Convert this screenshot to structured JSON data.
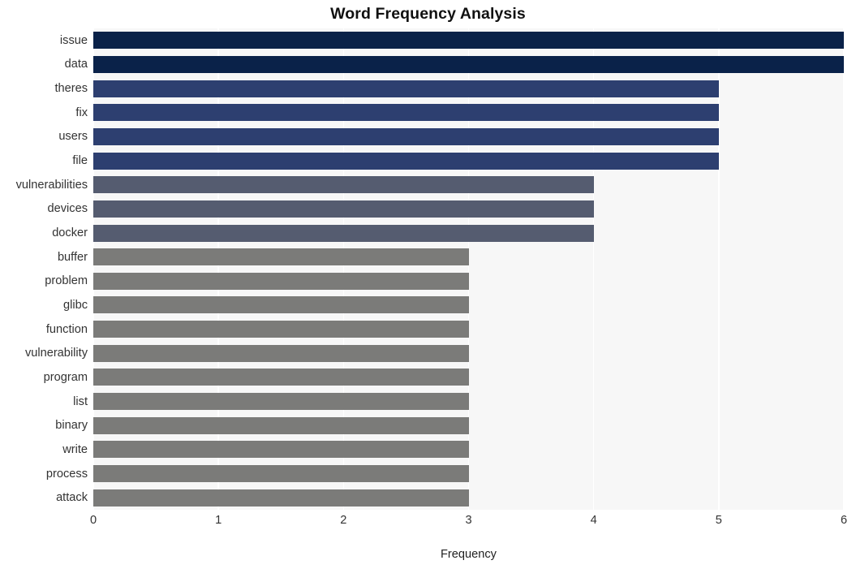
{
  "chart_data": {
    "type": "bar",
    "orientation": "horizontal",
    "title": "Word Frequency Analysis",
    "xlabel": "Frequency",
    "ylabel": "",
    "xlim": [
      0,
      6
    ],
    "xticks": [
      "0",
      "1",
      "2",
      "3",
      "4",
      "5",
      "6"
    ],
    "grid": "vertical",
    "legend": null,
    "categories": [
      "issue",
      "data",
      "theres",
      "fix",
      "users",
      "file",
      "vulnerabilities",
      "devices",
      "docker",
      "buffer",
      "problem",
      "glibc",
      "function",
      "vulnerability",
      "program",
      "list",
      "binary",
      "write",
      "process",
      "attack"
    ],
    "values": [
      6,
      6,
      5,
      5,
      5,
      5,
      4,
      4,
      4,
      3,
      3,
      3,
      3,
      3,
      3,
      3,
      3,
      3,
      3,
      3
    ],
    "bar_colors": [
      "#0a2249",
      "#0a2249",
      "#2d3f70",
      "#2d3f70",
      "#2d3f70",
      "#2d3f70",
      "#555c70",
      "#555c70",
      "#555c70",
      "#7b7b79",
      "#7b7b79",
      "#7b7b79",
      "#7b7b79",
      "#7b7b79",
      "#7b7b79",
      "#7b7b79",
      "#7b7b79",
      "#7b7b79",
      "#7b7b79",
      "#7b7b79"
    ]
  },
  "style": {
    "plot_background": "#f7f7f7",
    "figure_background": "#ffffff",
    "gridline_color": "#ffffff",
    "tick_label_color": "#333333",
    "title_color": "#111111"
  }
}
